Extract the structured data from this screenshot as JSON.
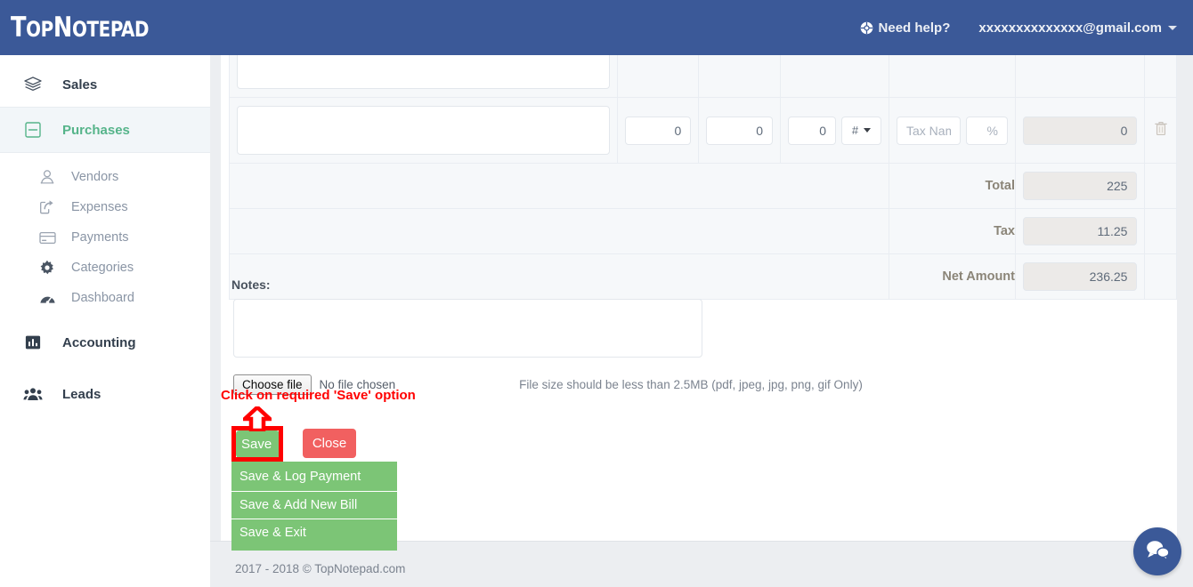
{
  "header": {
    "brand_top": "Top",
    "brand_note": "Notepad",
    "brand_full": "TopNotepad",
    "need_help_label": "Need help?",
    "help_icon": "help-circle-icon",
    "user_email": "xxxxxxxxxxxxxx@gmail.com",
    "caret_icon": "chevron-down-icon",
    "bg_color": "#3b5998"
  },
  "sidebar": {
    "items": [
      {
        "label": "Sales",
        "icon": "layers-icon",
        "level": "top",
        "active": false
      },
      {
        "label": "Purchases",
        "icon": "minus-box-icon",
        "level": "top",
        "active": true
      },
      {
        "label": "Vendors",
        "icon": "user-icon",
        "level": "sub",
        "active": false
      },
      {
        "label": "Expenses",
        "icon": "share-arrow-icon",
        "level": "sub",
        "active": false
      },
      {
        "label": "Payments",
        "icon": "credit-card-icon",
        "level": "sub",
        "active": false
      },
      {
        "label": "Categories",
        "icon": "gear-icon",
        "level": "sub",
        "active": false
      },
      {
        "label": "Dashboard",
        "icon": "speedometer-icon",
        "level": "sub",
        "active": false
      },
      {
        "label": "Accounting",
        "icon": "bar-chart-icon",
        "level": "top",
        "active": false
      },
      {
        "label": "Leads",
        "icon": "people-icon",
        "level": "top",
        "active": false
      }
    ],
    "active_color": "#56b48a"
  },
  "items_table": {
    "row_partial": {
      "description": ""
    },
    "row_new": {
      "description": "",
      "quantity": "0",
      "rate": "0",
      "discount": "0",
      "discount_unit": "#",
      "tax_name_placeholder": "Tax Name",
      "tax_percent_placeholder": "%",
      "amount": "0",
      "delete_icon": "trash-icon"
    },
    "totals": [
      {
        "label": "Total",
        "value": "225"
      },
      {
        "label": "Tax",
        "value": "11.25"
      },
      {
        "label": "Net Amount",
        "value": "236.25"
      }
    ]
  },
  "notes": {
    "label": "Notes:",
    "value": "",
    "placeholder": ""
  },
  "file_upload": {
    "button_label": "Choose file",
    "status": "No file chosen",
    "hint": "File size should be less than 2.5MB (pdf, jpeg, jpg, png, gif Only)"
  },
  "annotation": {
    "text": "Click on required 'Save' option",
    "color": "#ff0000",
    "arrow_icon": "arrow-up-icon"
  },
  "actions": {
    "save_label": "Save",
    "close_label": "Close",
    "save_color": "#7cc576",
    "close_color": "#f16060",
    "dropdown": [
      "Save & Log Payment",
      "Save & Add New Bill",
      "Save & Exit"
    ]
  },
  "footer": {
    "copyright": "2017 - 2018 © TopNotepad.com"
  },
  "chat": {
    "icon": "chat-bubbles-icon",
    "color": "#3b5998"
  }
}
